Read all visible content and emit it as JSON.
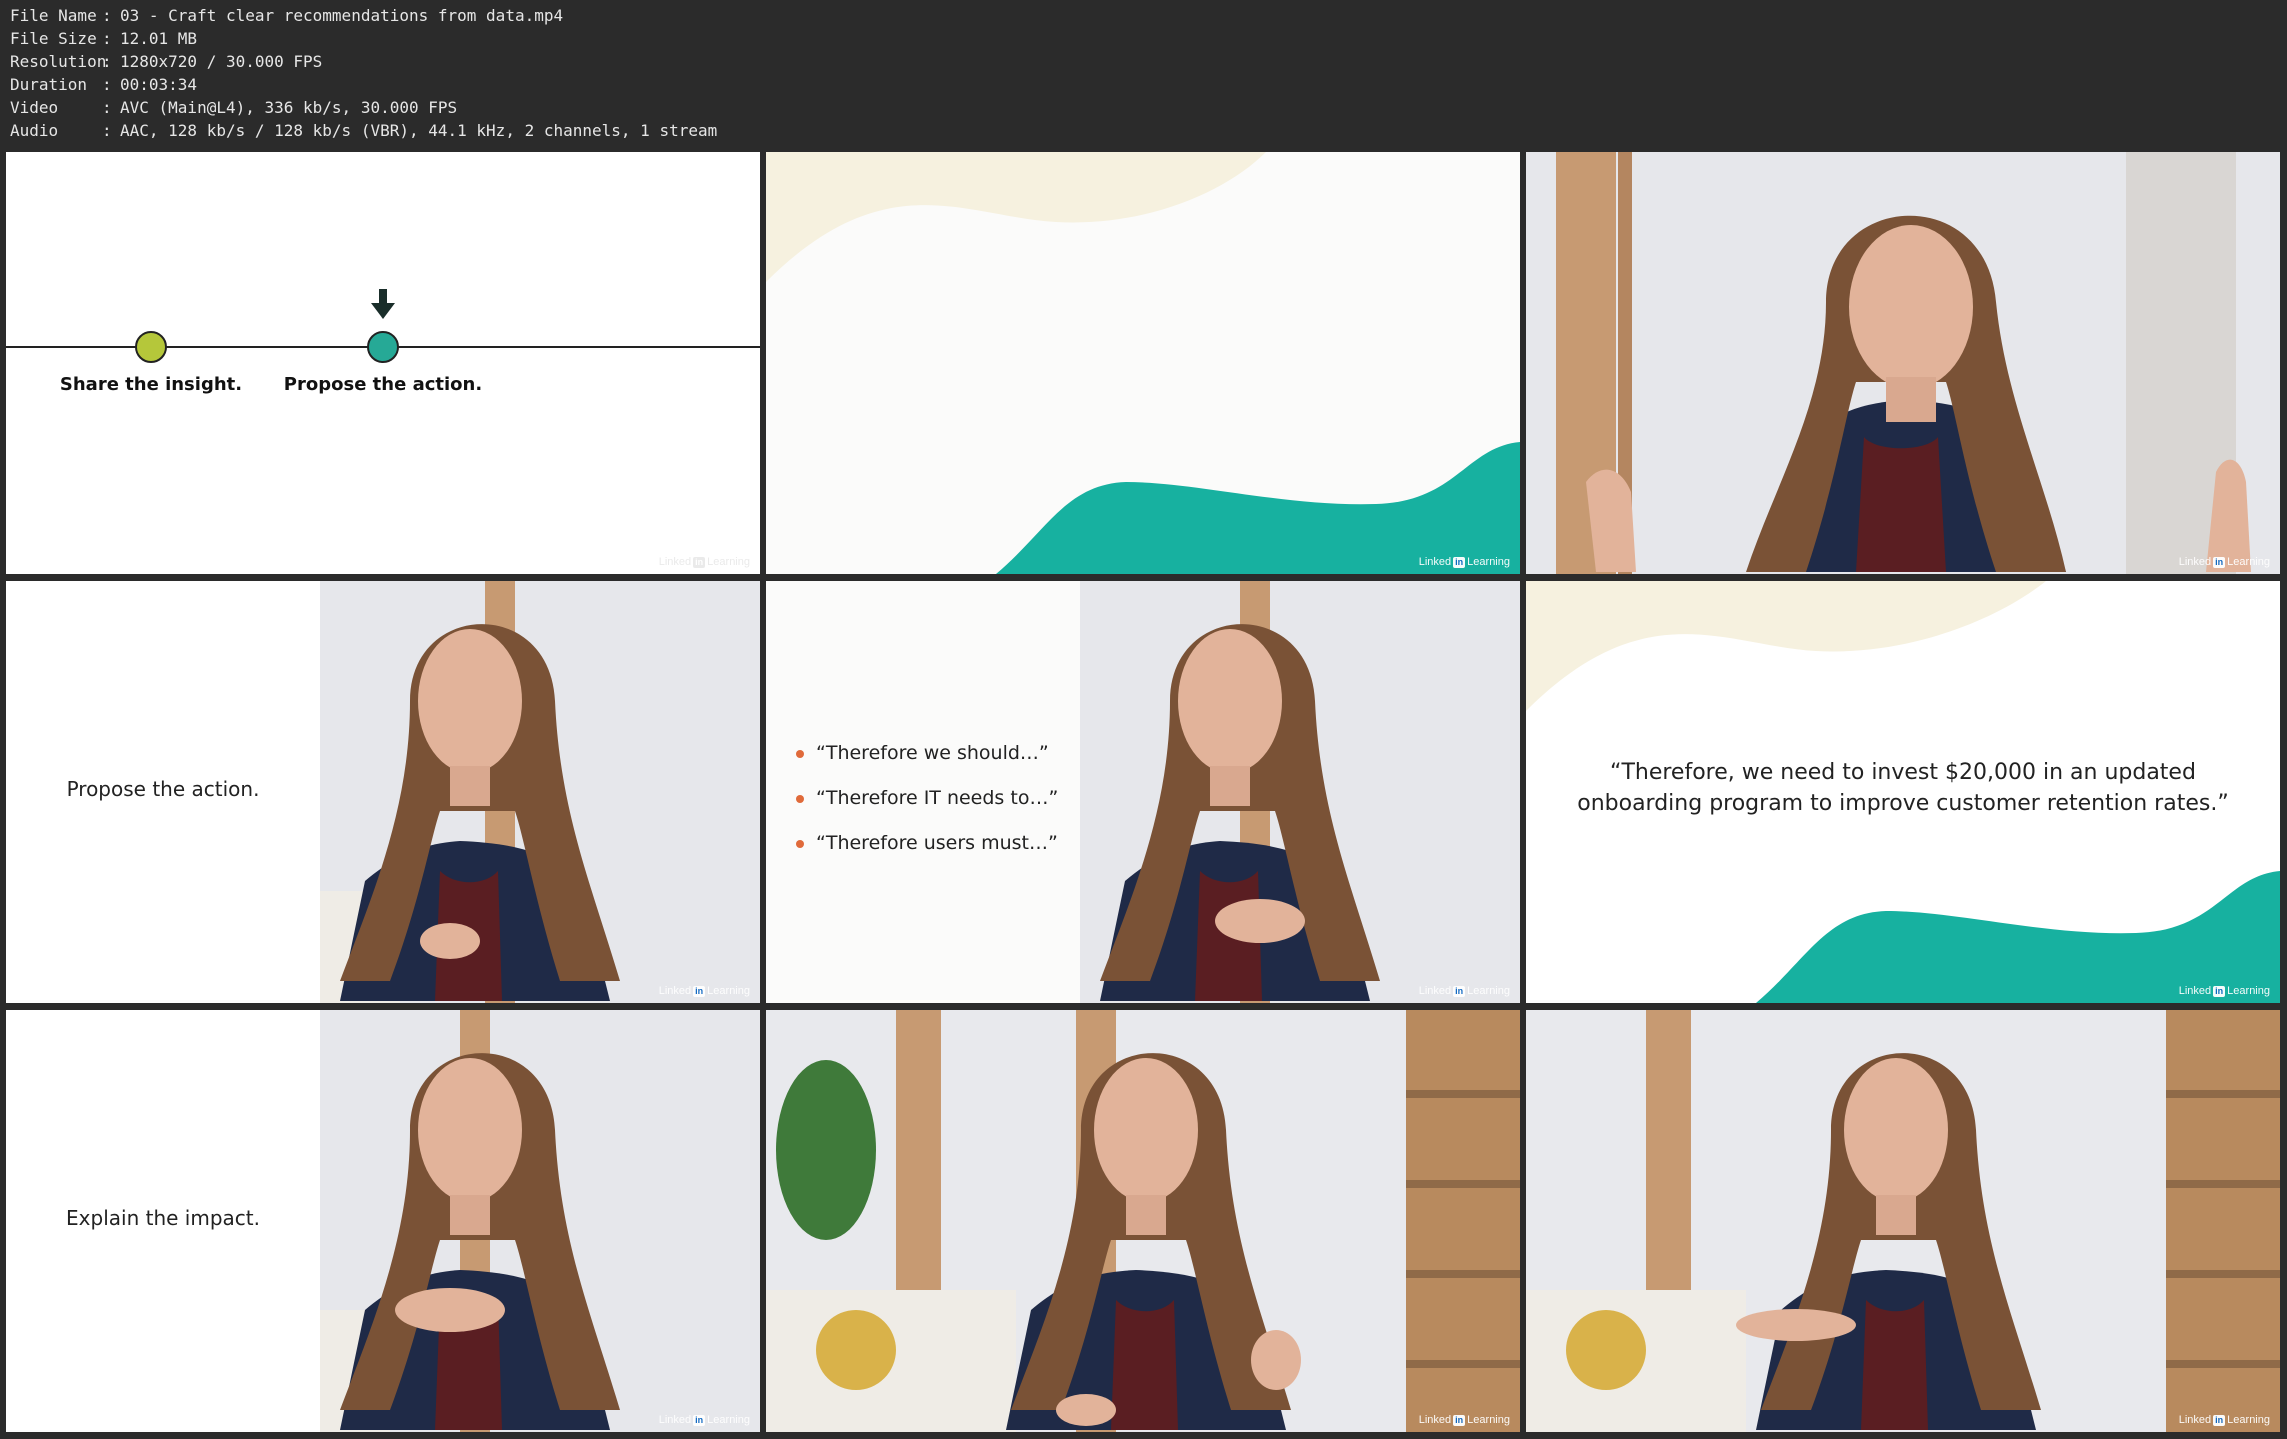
{
  "file_info": [
    {
      "key": "File Name",
      "value": "03 - Craft clear recommendations from data.mp4"
    },
    {
      "key": "File Size",
      "value": "12.01 MB"
    },
    {
      "key": "Resolution",
      "value": "1280x720 / 30.000 FPS"
    },
    {
      "key": "Duration",
      "value": "00:03:34"
    },
    {
      "key": "Video",
      "value": "AVC (Main@L4), 336 kb/s, 30.000 FPS"
    },
    {
      "key": "Audio",
      "value": "AAC, 128 kb/s / 128 kb/s (VBR), 44.1 kHz, 2 channels, 1 stream"
    }
  ],
  "separator": ":",
  "watermark": {
    "prefix": "Linked",
    "in": "in",
    "suffix": "Learning"
  },
  "frames": {
    "timeline": {
      "step1": "Share the insight.",
      "step2": "Propose the action."
    },
    "propose_caption": "Propose the action.",
    "bullets": [
      "“Therefore we should…”",
      "“Therefore IT needs to…”",
      "“Therefore users must…”"
    ],
    "quote_line1": "“Therefore, we need to invest $20,000 in an updated",
    "quote_line2": "onboarding program to improve customer retention rates.”",
    "impact_caption": "Explain the impact."
  },
  "colors": {
    "teal": "#17b1a0",
    "cream": "#f6f1df",
    "olive_dot": "#b5c73a",
    "teal_dot": "#26a996",
    "bullet": "#e06a3a",
    "jacket": "#1f2a47",
    "hair": "#7a5236",
    "skin": "#e2b39a",
    "wall": "#e7e8ec",
    "wood": "#c79a72"
  },
  "icons": [
    "down-arrow-icon"
  ]
}
